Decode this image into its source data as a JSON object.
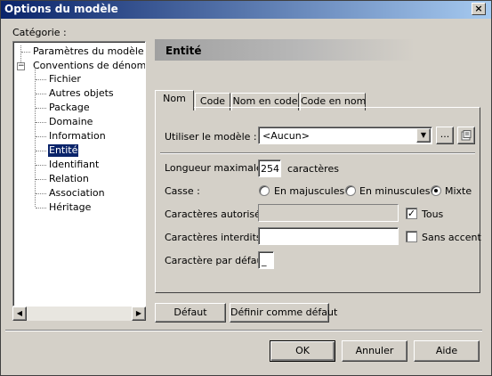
{
  "window": {
    "title": "Options du modèle",
    "close_glyph": "×"
  },
  "category_label": "Catégorie :",
  "tree": {
    "items": [
      {
        "label": "Paramètres du modèle"
      },
      {
        "label": "Conventions de dénominat",
        "expanded": true,
        "expander_glyph": "−"
      },
      {
        "label": "Fichier"
      },
      {
        "label": "Autres objets"
      },
      {
        "label": "Package"
      },
      {
        "label": "Domaine"
      },
      {
        "label": "Information"
      },
      {
        "label": "Entité",
        "selected": true
      },
      {
        "label": "Identifiant"
      },
      {
        "label": "Relation"
      },
      {
        "label": "Association"
      },
      {
        "label": "Héritage"
      }
    ]
  },
  "scrollbar": {
    "left_glyph": "◀",
    "right_glyph": "▶"
  },
  "panel": {
    "header": "Entité"
  },
  "tabs": [
    {
      "label": "Nom",
      "active": true
    },
    {
      "label": "Code"
    },
    {
      "label": "Nom en code"
    },
    {
      "label": "Code en nom"
    }
  ],
  "form": {
    "use_model_label": "Utiliser le modèle :",
    "use_model_value": "<Aucun>",
    "combo_arrow_glyph": "▼",
    "ellipsis_label": "...",
    "max_length_label": "Longueur maximale :",
    "max_length_value": "254",
    "max_length_unit": "caractères",
    "case_label": "Casse :",
    "case_options": [
      {
        "label": "En majuscules",
        "selected": false
      },
      {
        "label": "En minuscules",
        "selected": false
      },
      {
        "label": "Mixte",
        "selected": true
      }
    ],
    "allowed_chars_label": "Caractères autorisés :",
    "allowed_chars_value": "",
    "all_label": "Tous",
    "all_checked": true,
    "forbidden_chars_label": "Caractères interdits :",
    "forbidden_chars_value": "",
    "no_accent_label": "Sans accent",
    "no_accent_checked": false,
    "default_char_label": "Caractère par défaut :",
    "default_char_value": "_",
    "check_glyph": "✓"
  },
  "buttons": {
    "default": "Défaut",
    "set_default": "Définir comme défaut",
    "ok": "OK",
    "cancel": "Annuler",
    "help": "Aide"
  }
}
